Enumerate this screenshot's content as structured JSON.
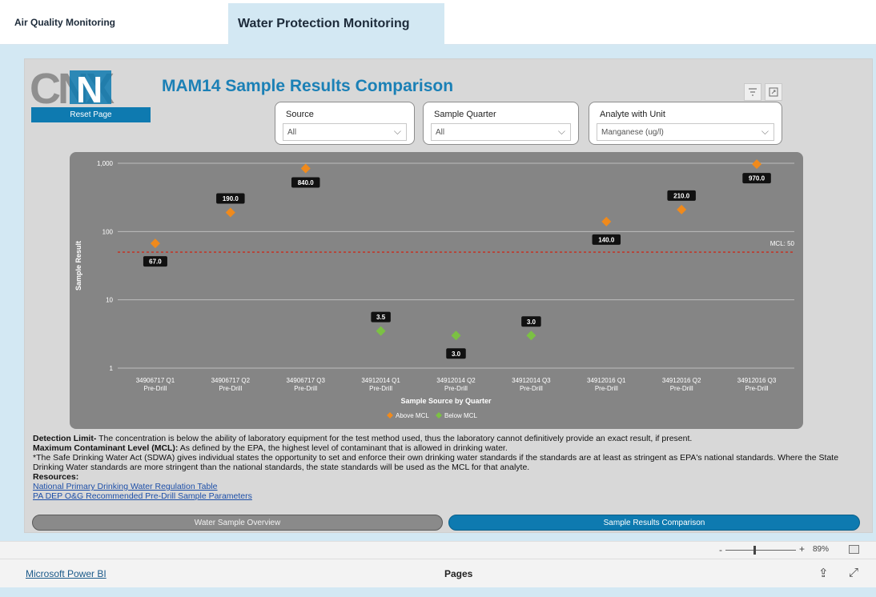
{
  "tabs": [
    {
      "label": "Air Quality Monitoring",
      "active": false
    },
    {
      "label": "Water Protection Monitoring",
      "active": true
    }
  ],
  "report": {
    "logo_text": "CNX",
    "reset_label": "Reset Page",
    "title": "MAM14 Sample Results Comparison",
    "filter_icon": "filter-icon",
    "focus_icon": "focus-mode-icon"
  },
  "slicers": [
    {
      "label": "Source",
      "value": "All"
    },
    {
      "label": "Sample Quarter",
      "value": "All"
    },
    {
      "label": "Analyte with Unit",
      "value": "Manganese (ug/l)"
    }
  ],
  "chart_data": {
    "type": "scatter",
    "xlabel": "Sample Source by Quarter",
    "ylabel": "Sample Result",
    "y_scale": "log",
    "ylim": [
      1,
      1000
    ],
    "y_ticks": [
      "1",
      "10",
      "100",
      "1,000"
    ],
    "categories": [
      [
        "34906717 Q1",
        "Pre-Drill"
      ],
      [
        "34906717 Q2",
        "Pre-Drill"
      ],
      [
        "34906717 Q3",
        "Pre-Drill"
      ],
      [
        "34912014 Q1",
        "Pre-Drill"
      ],
      [
        "34912014 Q2",
        "Pre-Drill"
      ],
      [
        "34912014 Q3",
        "Pre-Drill"
      ],
      [
        "34912016 Q1",
        "Pre-Drill"
      ],
      [
        "34912016 Q2",
        "Pre-Drill"
      ],
      [
        "34912016 Q3",
        "Pre-Drill"
      ]
    ],
    "values": [
      67.0,
      190.0,
      840.0,
      3.5,
      3.0,
      3.0,
      140.0,
      210.0,
      970.0
    ],
    "labels": [
      "67.0",
      "190.0",
      "840.0",
      "3.5",
      "3.0",
      "3.0",
      "140.0",
      "210.0",
      "970.0"
    ],
    "status": [
      "above",
      "above",
      "above",
      "below",
      "below",
      "below",
      "above",
      "above",
      "above"
    ],
    "mcl": {
      "value": 50,
      "label": "MCL: 50"
    },
    "grid": true,
    "legend_position": "bottom",
    "series": [
      {
        "name": "Above MCL",
        "color": "#f08a1c"
      },
      {
        "name": "Below MCL",
        "color": "#7bc143"
      }
    ]
  },
  "notes": {
    "detection_title": "Detection Limit-",
    "detection_text": " The concentration is below the ability of laboratory equipment for the test method used, thus the laboratory cannot definitively provide an exact result, if present.",
    "mcl_title": "Maximum Contaminant Level (MCL):",
    "mcl_text": " As defined by the EPA, the highest level of contaminant that is allowed in drinking water.",
    "sdwa_text": "*The Safe Drinking Water Act (SDWA) gives individual states the opportunity to set and enforce their own drinking water standards if the standards are at least as stringent as EPA's national standards.  Where the State Drinking Water standards are more stringent than the national standards, the state standards will be used as the MCL for that analyte.",
    "resources_title": "Resources:",
    "links": [
      "National Primary Drinking Water Regulation Table",
      "PA DEP O&G Recommended Pre-Drill Sample Parameters"
    ]
  },
  "page_buttons": {
    "overview": "Water Sample Overview",
    "comparison": "Sample Results Comparison"
  },
  "zoom": {
    "minus": "-",
    "plus": "+",
    "level": "89%",
    "fit_icon": "fit-to-page-icon"
  },
  "footer": {
    "brand_link": "Microsoft Power BI",
    "pages_label": "Pages",
    "share_icon": "share-icon",
    "fullscreen_icon": "fullscreen-icon"
  },
  "colors": {
    "accent": "#1b80b6",
    "button": "#0e7ab0",
    "chart_bg": "#858585",
    "mcl_line": "#c0392b"
  }
}
